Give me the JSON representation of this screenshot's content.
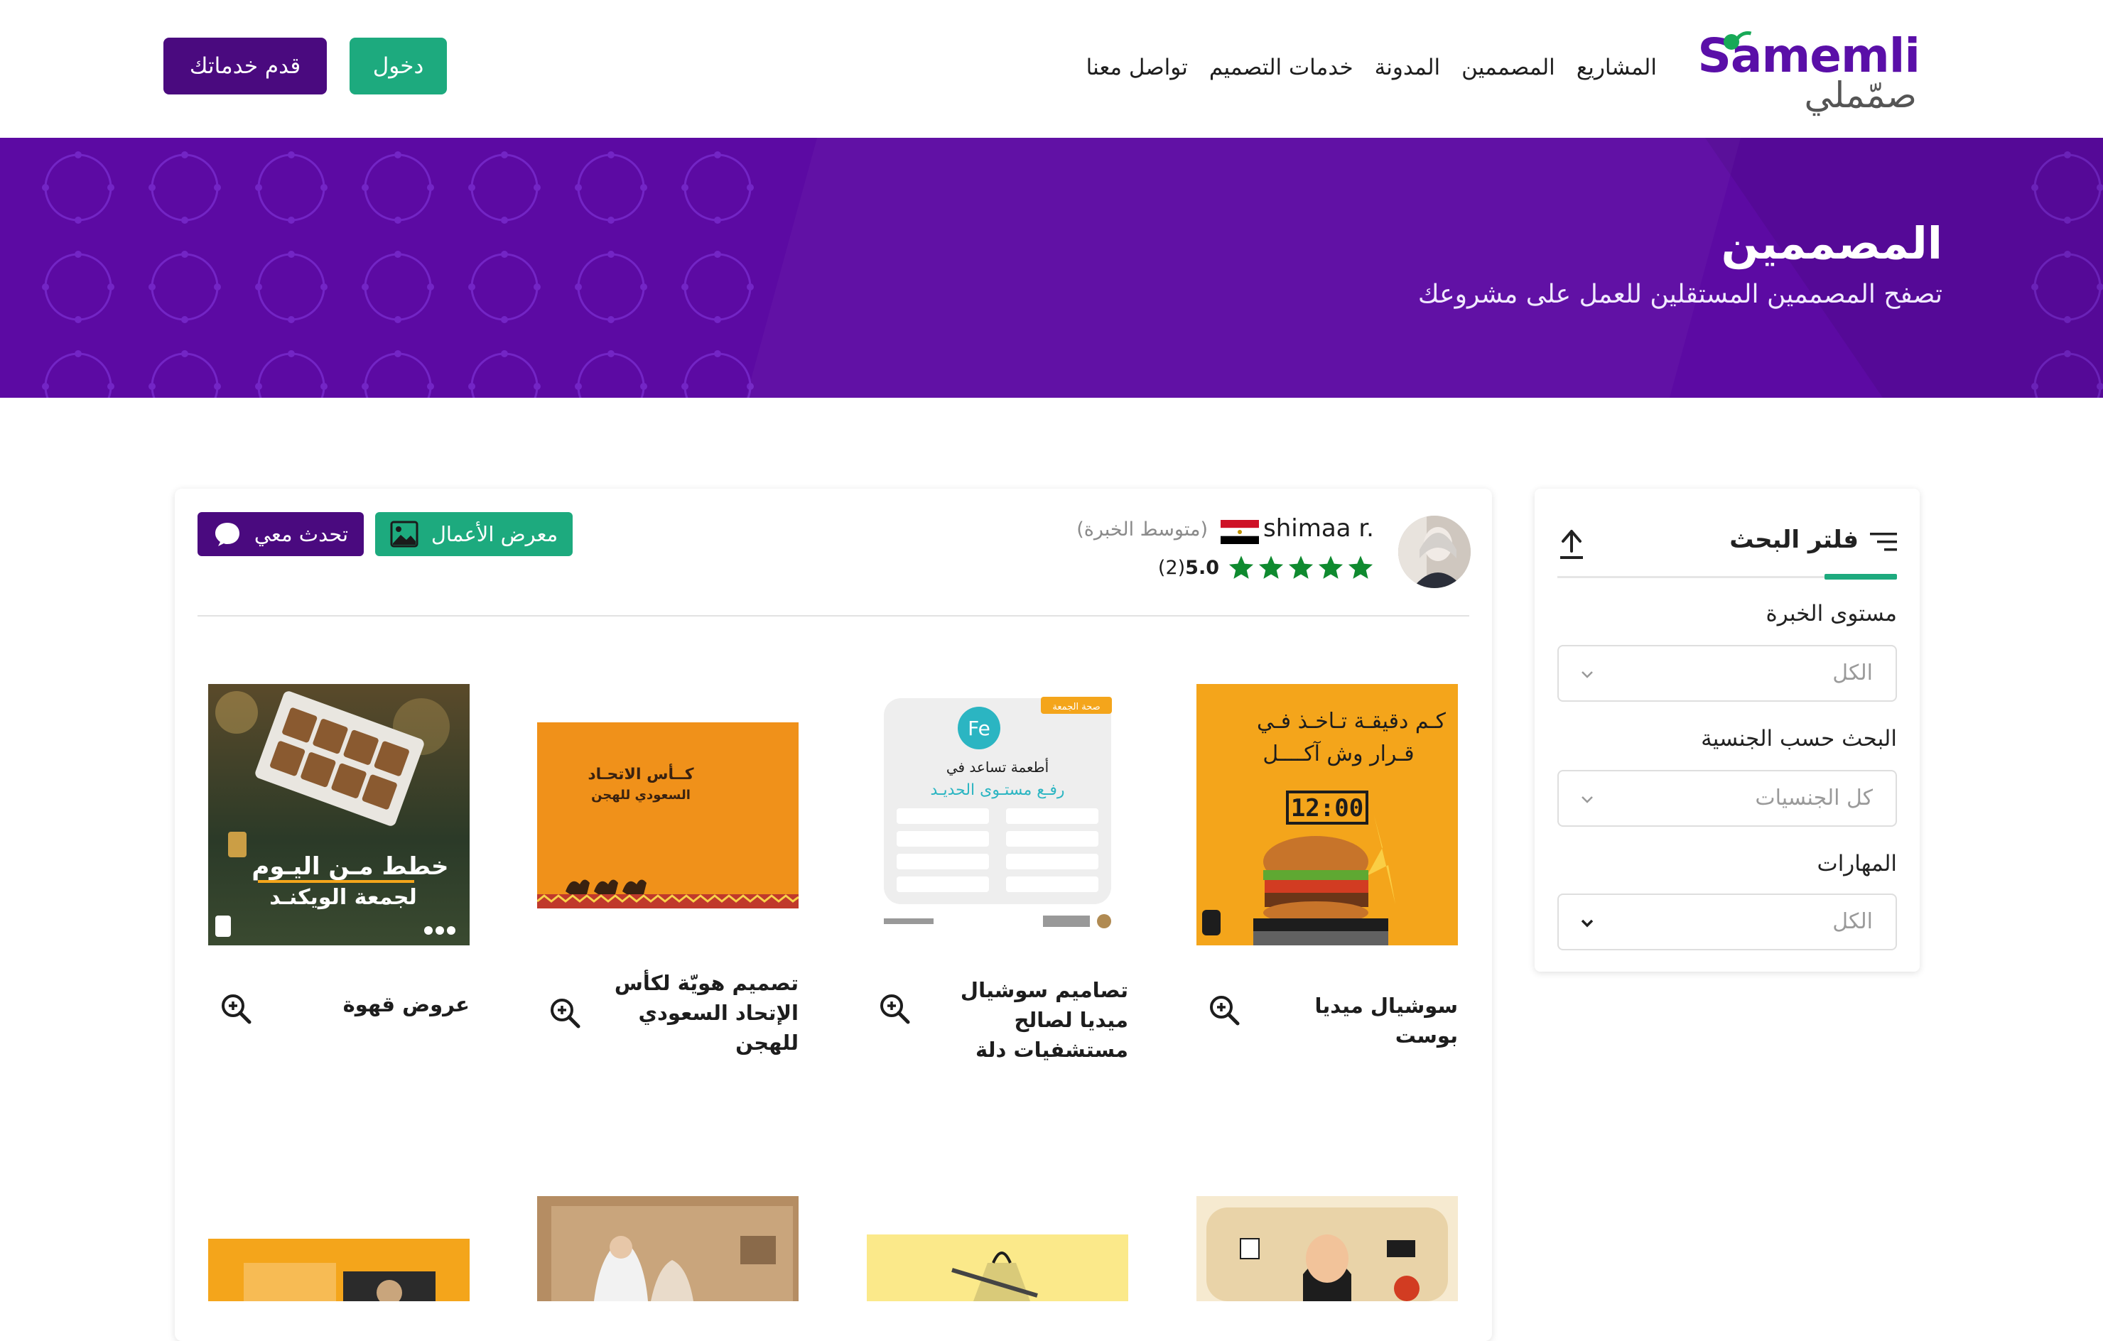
{
  "header": {
    "logo_latin": "Sameml",
    "logo_arabic": "صمّملي",
    "nav": [
      "المشاريع",
      "المصممين",
      "المدونة",
      "خدمات التصميم",
      "تواصل معنا"
    ],
    "login_label": "دخول",
    "offer_label": "قدم خدماتك"
  },
  "hero": {
    "title": "المصممين",
    "subtitle": "تصفح المصممين المستقلين للعمل على مشروعك"
  },
  "filter": {
    "title": "فلتر البحث",
    "experience_label": "مستوى الخبرة",
    "experience_value": "الكل",
    "nationality_label": "البحث حسب الجنسية",
    "nationality_value": "كل الجنسيات",
    "skills_label": "المهارات",
    "skills_value": "الكل"
  },
  "designer": {
    "name": "shimaa r.",
    "level": "(متوسط الخبرة)",
    "rating": "5.0",
    "reviews": "(2)",
    "stars": 5,
    "portfolio_label": "معرض الأعمال",
    "chat_label": "تحدث معي",
    "works": [
      {
        "title": "سوشيال ميديا بوست",
        "thumb_text": [
          "كـم دقيقـة تـاخـذ فـي",
          "قـرار وش آكــــل",
          "12:00"
        ]
      },
      {
        "title": "تصاميم سوشيال ميديا لصالح مستشفيات دلة",
        "thumb_text": [
          "صحة الجمعة",
          "Fe",
          "أطعمة تساعد في",
          "رفـع مستـوى الحديـد"
        ]
      },
      {
        "title": "تصميم هويّة لكأس الإتحاد السعودي للهجن",
        "thumb_text": [
          "كــأس الاتحـاد",
          "السعودي للهجن"
        ]
      },
      {
        "title": "عروض قهوة",
        "thumb_text": [
          "خطط مـن اليـوم",
          "لجمعة الويكنـد"
        ]
      }
    ]
  },
  "colors": {
    "brand_purple": "#5c0aa3",
    "dark_purple": "#4a0a7f",
    "green": "#1daa7e",
    "star_green": "#0f8a2f"
  }
}
